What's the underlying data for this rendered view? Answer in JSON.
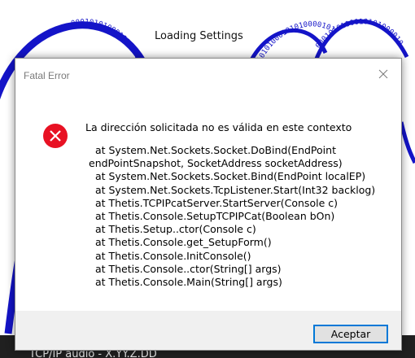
{
  "splash": {
    "title": "Loading Settings",
    "binary_text": "0001010100010101000010101001010100010101000101010",
    "status_text": "TCP/IP audio - X.YY.Z.DD"
  },
  "dialog": {
    "title": "Fatal Error",
    "close_icon": "close-icon",
    "error_icon": "error-icon",
    "message": "La dirección solicitada no es válida en este contexto",
    "stack_trace": [
      "  at System.Net.Sockets.Socket.DoBind(EndPoint",
      "endPointSnapshot, SocketAddress socketAddress)",
      "  at System.Net.Sockets.Socket.Bind(EndPoint localEP)",
      "  at System.Net.Sockets.TcpListener.Start(Int32 backlog)",
      "  at Thetis.TCPIPcatServer.StartServer(Console c)",
      "  at Thetis.Console.SetupTCPIPCat(Boolean bOn)",
      "  at Thetis.Setup..ctor(Console c)",
      "  at Thetis.Console.get_SetupForm()",
      "  at Thetis.Console.InitConsole()",
      "  at Thetis.Console..ctor(String[] args)",
      "  at Thetis.Console.Main(String[] args)"
    ],
    "ok_button_label": "Aceptar"
  },
  "colors": {
    "accent": "#0078d7",
    "error_red": "#e81123",
    "wave_blue": "#1414c8"
  }
}
